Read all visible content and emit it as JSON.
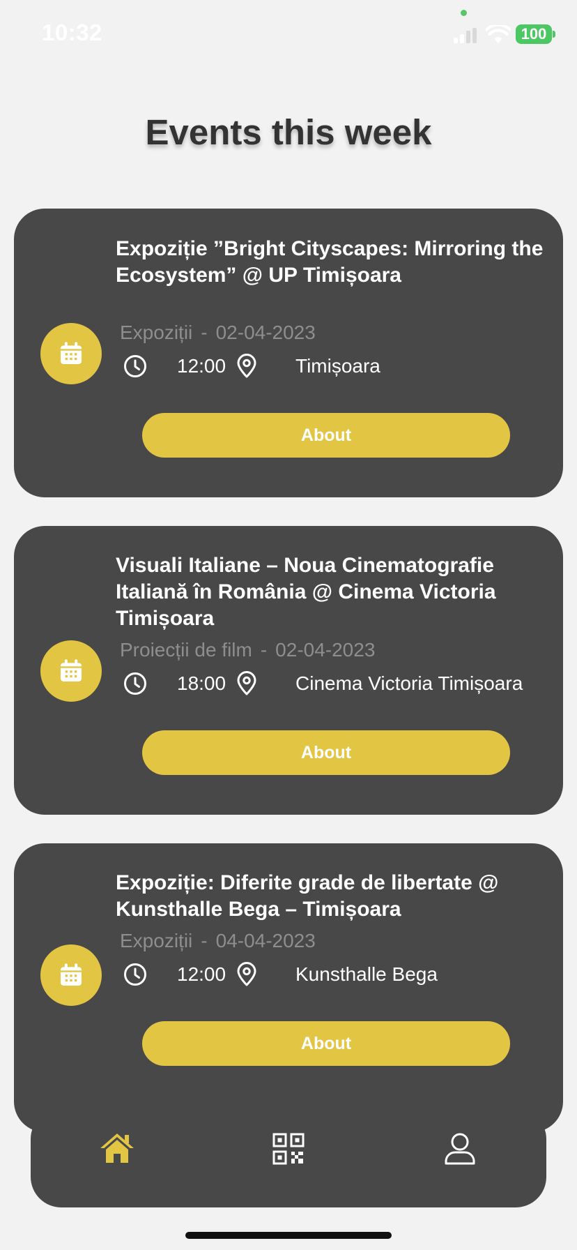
{
  "status_bar": {
    "time": "10:32",
    "battery": "100"
  },
  "header": {
    "title": "Events this week"
  },
  "events": [
    {
      "title": "Expoziție ”Bright Cityscapes: Mirroring the Ecosystem” @ UP Timișoara",
      "category": "Expoziții",
      "separator": "-",
      "date": "02-04-2023",
      "time": "12:00",
      "location": "Timișoara",
      "button_label": "About"
    },
    {
      "title": "Visuali Italiane – Noua Cinematografie Italiană în România @ Cinema Victoria Timișoara",
      "category": "Proiecții de film",
      "separator": "-",
      "date": "02-04-2023",
      "time": "18:00",
      "location": "Cinema Victoria Timișoara",
      "button_label": "About"
    },
    {
      "title": "Expoziție: Diferite grade de libertate @ Kunsthalle Bega – Timișoara",
      "category": "Expoziții",
      "separator": "-",
      "date": "04-04-2023",
      "time": "12:00",
      "location": "Kunsthalle Bega",
      "button_label": "About"
    }
  ],
  "icons": {
    "event": "calendar-icon",
    "time": "clock-icon",
    "location": "location-pin-icon",
    "nav": [
      "home-icon",
      "qr-code-icon",
      "profile-icon"
    ]
  },
  "colors": {
    "accent": "#e3c544",
    "card_background": "#484848",
    "page_background": "#f2f2f2",
    "muted_text": "#8e8e8e",
    "active_nav": "#e3c544"
  }
}
